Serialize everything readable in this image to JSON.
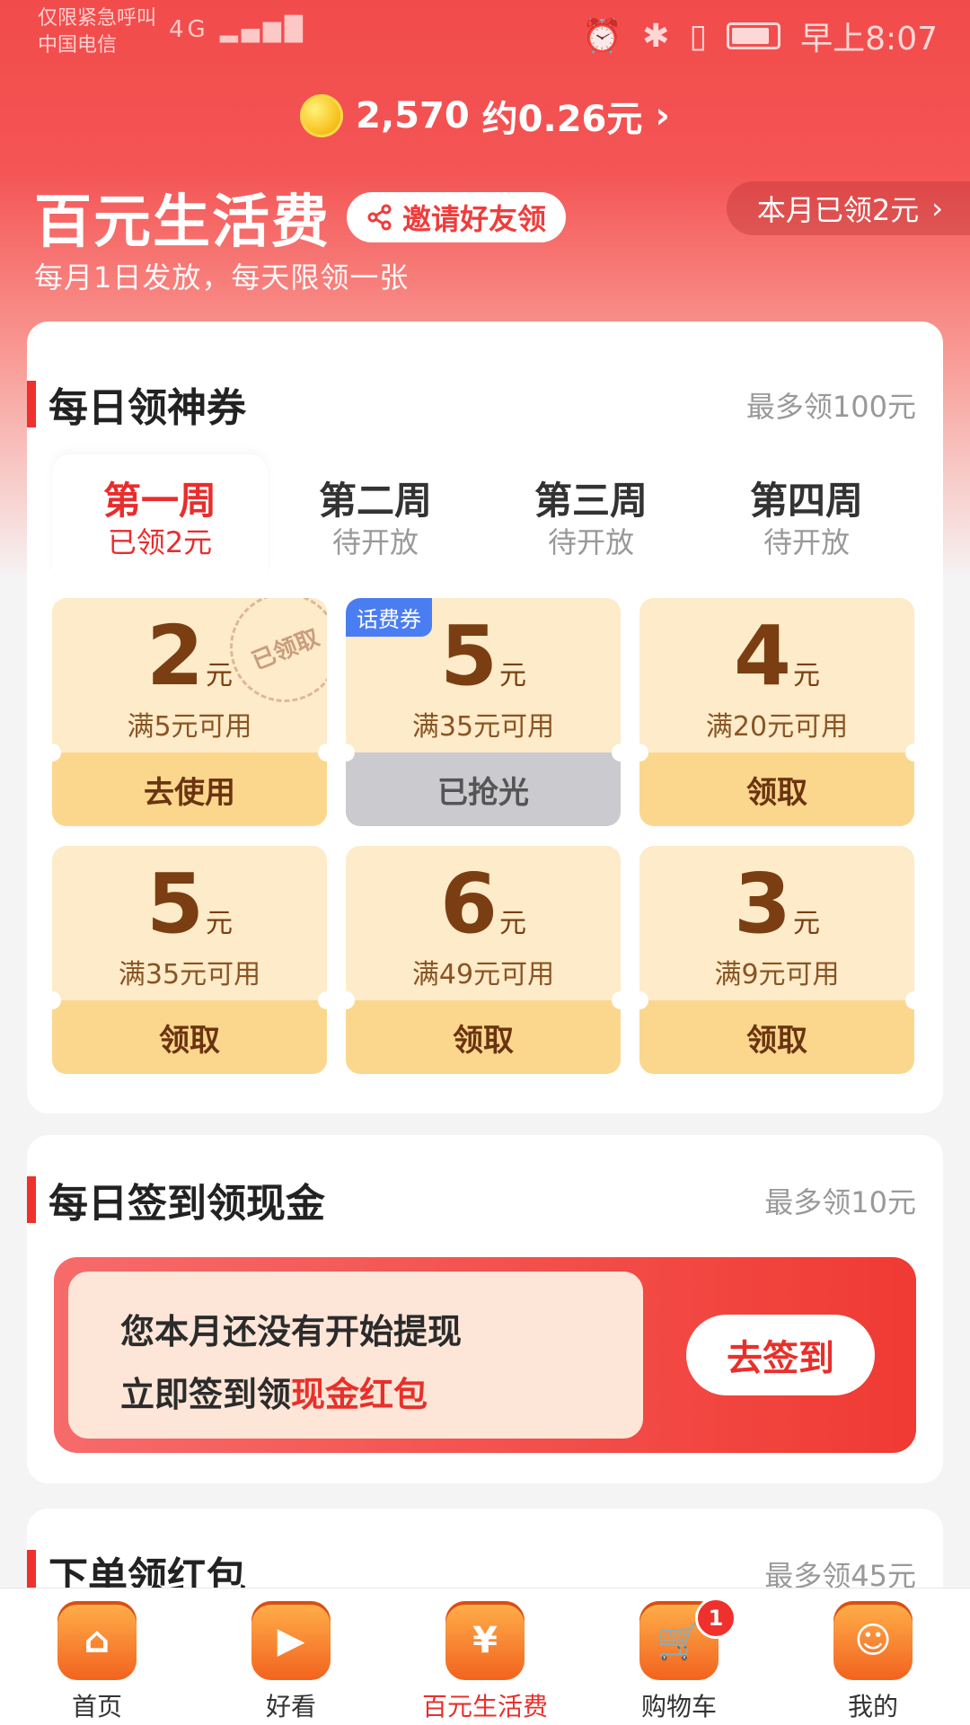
{
  "status_bar": {
    "emergency_text": "仅限紧急呼叫",
    "carrier": "中国电信",
    "network": "4G",
    "time": "早上8:07"
  },
  "coin_bar": {
    "coins": "2,570",
    "approx": "约0.26元",
    "chevron": "›"
  },
  "header": {
    "title": "百元生活费",
    "invite_label": "邀请好友领",
    "monthly_label": "本月已领2元",
    "subtitle": "每月1日发放，每天限领一张"
  },
  "daily_coupons": {
    "title": "每日领神券",
    "note": "最多领100元",
    "weeks": [
      {
        "name": "第一周",
        "status": "已领2元"
      },
      {
        "name": "第二周",
        "status": "待开放"
      },
      {
        "name": "第三周",
        "status": "待开放"
      },
      {
        "name": "第四周",
        "status": "待开放"
      }
    ],
    "coupons": [
      {
        "amount": "2",
        "unit": "元",
        "condition": "满5元可用",
        "button": "去使用",
        "stamp": "已领取"
      },
      {
        "amount": "5",
        "unit": "元",
        "condition": "满35元可用",
        "button": "已抢光",
        "tag": "话费券"
      },
      {
        "amount": "4",
        "unit": "元",
        "condition": "满20元可用",
        "button": "领取"
      },
      {
        "amount": "5",
        "unit": "元",
        "condition": "满35元可用",
        "button": "领取"
      },
      {
        "amount": "6",
        "unit": "元",
        "condition": "满49元可用",
        "button": "领取"
      },
      {
        "amount": "3",
        "unit": "元",
        "condition": "满9元可用",
        "button": "领取"
      }
    ]
  },
  "daily_checkin": {
    "title": "每日签到领现金",
    "note": "最多领10元",
    "line1": "您本月还没有开始提现",
    "line2_prefix": "立即签到领",
    "line2_highlight": "现金红包",
    "button": "去签到"
  },
  "order_red_packet": {
    "title": "下单领红包",
    "note": "最多领45元"
  },
  "tab_bar": {
    "tabs": [
      {
        "label": "首页",
        "icon": "home-icon"
      },
      {
        "label": "好看",
        "icon": "video-icon"
      },
      {
        "label": "百元生活费",
        "icon": "yuan-icon"
      },
      {
        "label": "购物车",
        "icon": "cart-icon"
      },
      {
        "label": "我的",
        "icon": "profile-icon"
      }
    ],
    "active_index": 2,
    "cart_badge": "1"
  }
}
